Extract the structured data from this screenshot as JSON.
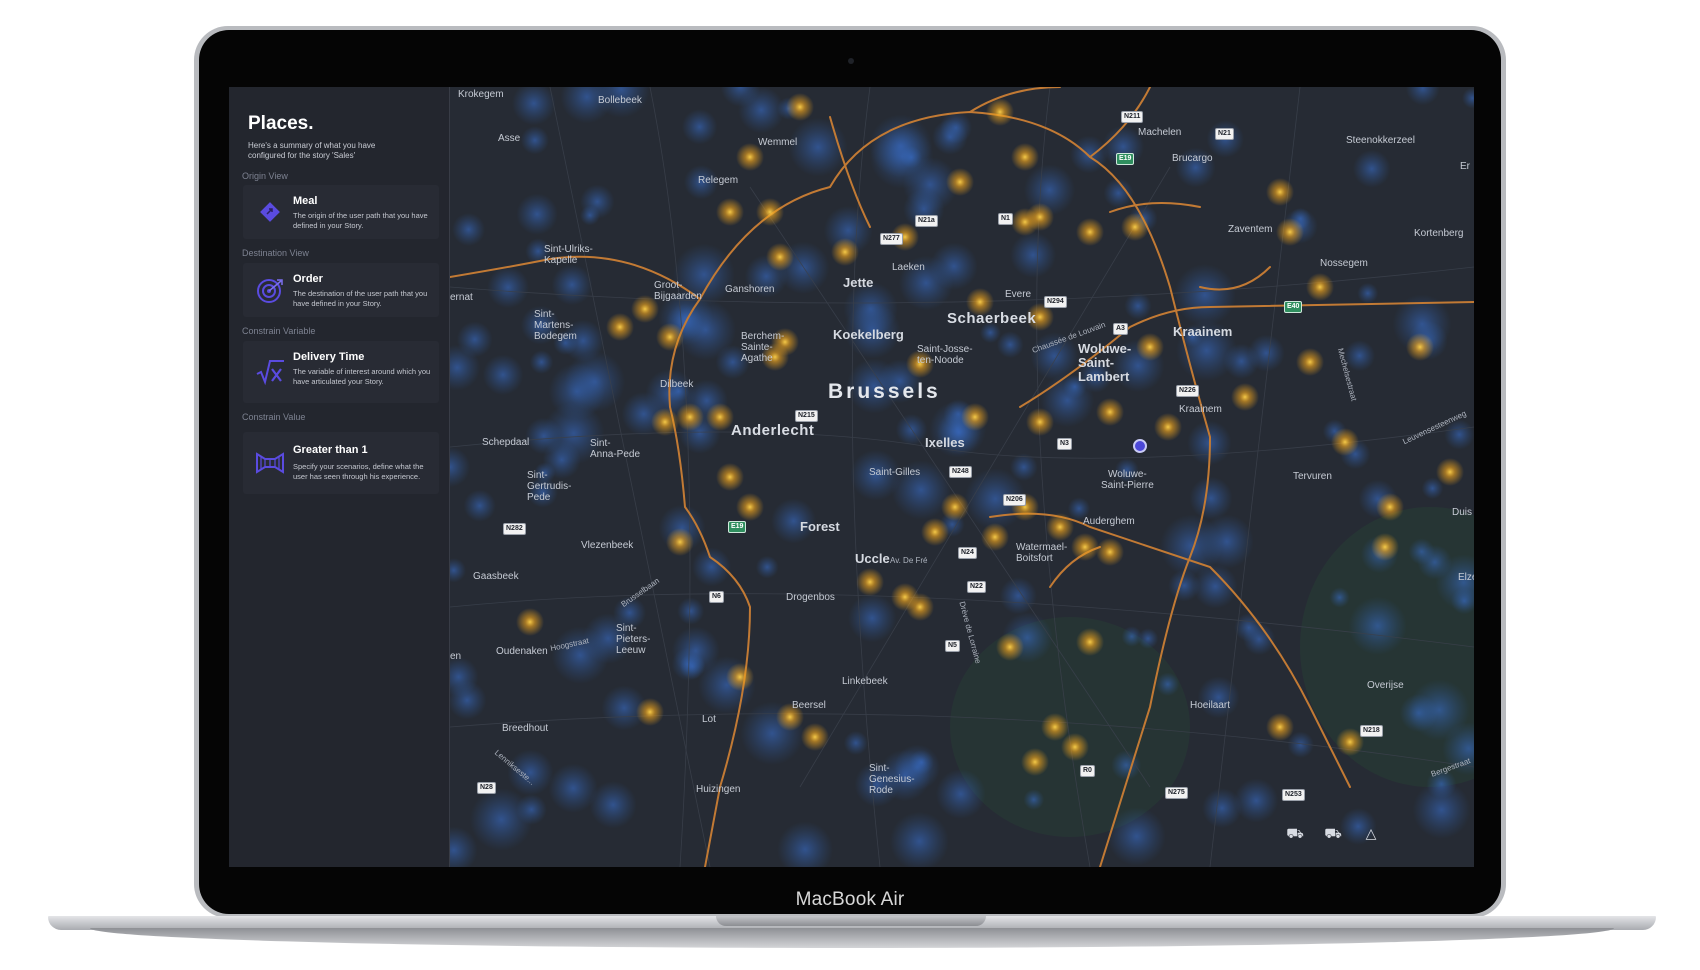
{
  "device": {
    "label": "MacBook Air"
  },
  "sidebar": {
    "title": "Places.",
    "subtitle": "Here's a summary of what you have configured for the story 'Sales'",
    "sections": [
      {
        "label": "Origin View",
        "title": "Meal",
        "desc": "The origin of the user path that you have defined in your Story.",
        "icon": "diamond-arrow-icon"
      },
      {
        "label": "Destination View",
        "title": "Order",
        "desc": "The destination of the user path that you have defined in your Story.",
        "icon": "target-icon"
      },
      {
        "label": "Constrain Variable",
        "title": "Delivery Time",
        "desc": "The variable of interest around which you have articulated your Story.",
        "icon": "sqrt-x-icon"
      },
      {
        "label": "Constrain Value",
        "title": "Greater than 1",
        "desc": "Specify your scenarios, define what the user has seen through his experience.",
        "icon": "funnel-frame-icon"
      }
    ]
  },
  "map": {
    "city": "Brussels",
    "districts": {
      "schaerbeek": "Schaerbeek",
      "anderlecht": "Anderlecht",
      "woluwe_lambert": "Woluwe-\nSaint-\nLambert",
      "kraainem": "Kraainem",
      "jette": "Jette",
      "koekelberg": "Koekelberg",
      "ixelles": "Ixelles",
      "forest": "Forest",
      "uccle": "Uccle"
    },
    "places": {
      "krokegem": "Krokegem",
      "bollebeek": "Bollebeek",
      "asse": "Asse",
      "wemmel": "Wemmel",
      "relegem": "Relegem",
      "machelen": "Machelen",
      "brucargo": "Brucargo",
      "steenokkerzeel": "Steenokkerzeel",
      "zaventem": "Zaventem",
      "kortenberg": "Kortenberg",
      "nossegem": "Nossegem",
      "sint_ulriks": "Sint-Ulriks-\nKapelle",
      "groot_bijgaarden": "Groot-\nBijgaarden",
      "ganshoren": "Ganshoren",
      "laeken": "Laeken",
      "evere": "Evere",
      "ternat": "ernat",
      "sint_martens": "Sint-\nMartens-\nBodegem",
      "berchem": "Berchem-\nSainte-\nAgathe",
      "saint_josse": "Saint-Josse-\nten-Noode",
      "dilbeek": "Dilbeek",
      "kraainem_small": "Kraainem",
      "schepdaal": "Schepdaal",
      "sint_anna": "Sint-\nAnna-Pede",
      "woluwe_pierre": "Woluwe-\nSaint-Pierre",
      "tervuren": "Tervuren",
      "sint_gertrudis": "Sint-\nGertrudis-\nPede",
      "saint_gilles": "Saint-Gilles",
      "auderghem": "Auderghem",
      "duisburg": "Duis",
      "watermael": "Watermael-\nBoitsfort",
      "vlezenbeek": "Vlezenbeek",
      "gaasbeek": "Gaasbeek",
      "drogenbos": "Drogenbos",
      "elzer": "Elzer",
      "sint_pieters": "Sint-\nPieters-\nLeeuw",
      "oudenaken": "Oudenaken",
      "linkebeek": "Linkebeek",
      "overijse": "Overijse",
      "beersel": "Beersel",
      "hoeilaart": "Hoeilaart",
      "breedhout": "Breedhout",
      "lot": "Lot",
      "sint_genesius": "Sint-\nGenesius-\nRode",
      "huizingen": "Huizingen",
      "en": "en",
      "er": "Er"
    },
    "streets": {
      "chaussee_louvain": "Chaussée de Louvain",
      "av_de_fre": "Av. De Fré",
      "drève_lorraine": "Drève de Lorraine",
      "brusselbaan": "Brusselbaan",
      "hoogstraat": "Hoogstraat",
      "leuvensesteenweg": "Leuvensesteenweg",
      "mechelsestraat": "Mechelsestraat",
      "bergestraat": "Bergestraat",
      "lennikstraat": "Lennikseste..."
    },
    "shields": {
      "n211": "N211",
      "n21": "N21",
      "e19": "E19",
      "n21a": "N21a",
      "n1": "N1",
      "n277": "N277",
      "n294": "N294",
      "e40": "E40",
      "a3": "A3",
      "n226": "N226",
      "n215": "N215",
      "n3": "N3",
      "n248": "N248",
      "n206": "N206",
      "e19b": "E19",
      "n282": "N282",
      "n24": "N24",
      "n22": "N22",
      "n6": "N6",
      "n5": "N5",
      "n218": "N218",
      "r0": "R0",
      "n275": "N275",
      "n253": "N253",
      "n28": "N28"
    },
    "controls": [
      "car-icon",
      "car-icon",
      "basket-icon"
    ],
    "colors": {
      "road": "#c27a34",
      "heat_high": "#f1b61c",
      "heat_low": "#2f5fa8",
      "background": "#262b34",
      "marker": "#4c48d8"
    }
  }
}
